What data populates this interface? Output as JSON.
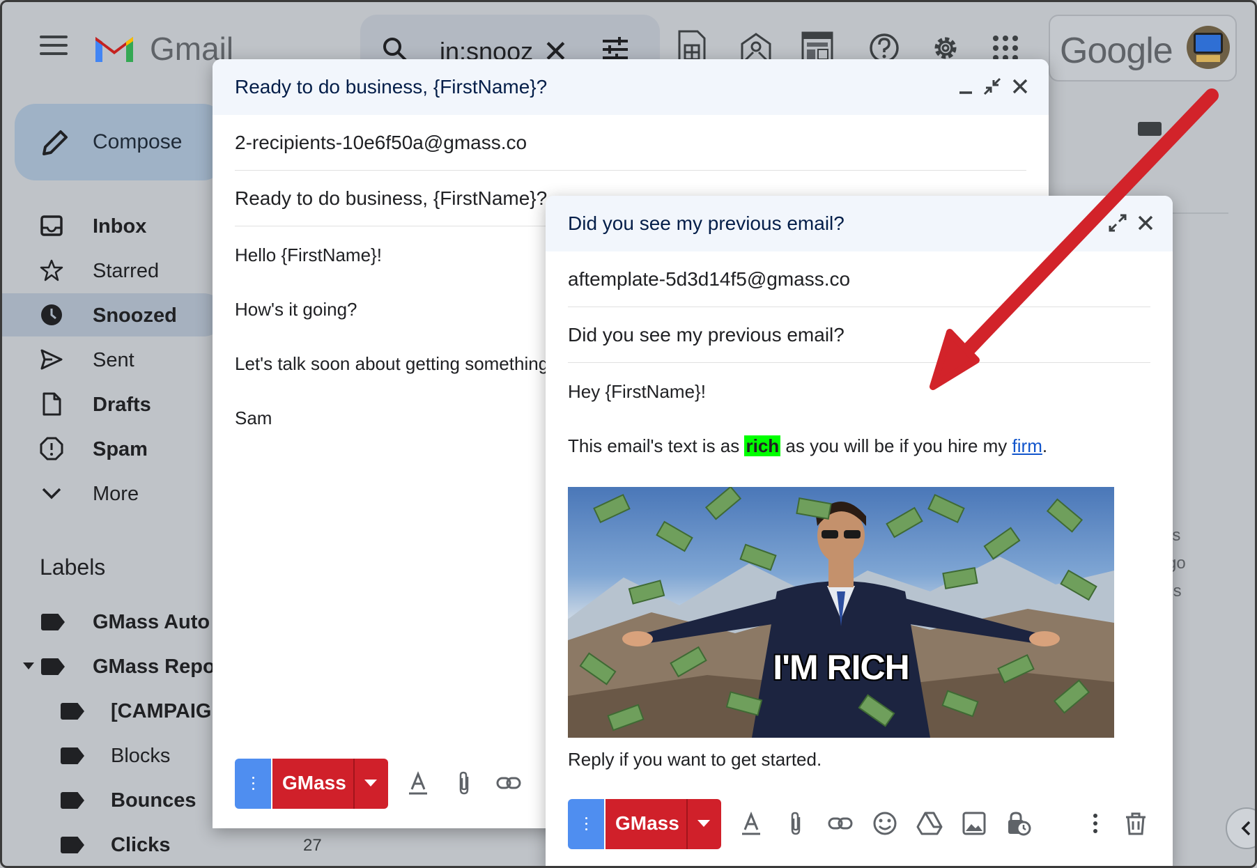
{
  "app": {
    "name": "Gmail",
    "account_brand": "Google"
  },
  "search": {
    "query": "in:snooz"
  },
  "nav": {
    "compose_label": "Compose",
    "items": [
      {
        "label": "Inbox",
        "bold": true
      },
      {
        "label": "Starred",
        "bold": false
      },
      {
        "label": "Snoozed",
        "bold": true,
        "active": true
      },
      {
        "label": "Sent",
        "bold": false
      },
      {
        "label": "Drafts",
        "bold": true
      },
      {
        "label": "Spam",
        "bold": true
      },
      {
        "label": "More",
        "bold": false
      }
    ]
  },
  "labels": {
    "title": "Labels",
    "items": [
      {
        "label": "GMass Auto",
        "bold": true
      },
      {
        "label": "GMass Repo",
        "bold": true
      },
      {
        "label": "[CAMPAIG",
        "bold": true
      },
      {
        "label": "Blocks",
        "bold": false
      },
      {
        "label": "Bounces",
        "bold": true
      },
      {
        "label": "Clicks",
        "bold": true,
        "count": "27"
      }
    ]
  },
  "background_fragments": [
    "es",
    "go",
    "ils"
  ],
  "draft1": {
    "header_title": "Ready to do business, {FirstName}?",
    "to": "2-recipients-10e6f50a@gmass.co",
    "subject": "Ready to do business, {FirstName}?",
    "body": [
      "Hello {FirstName}!",
      "How's it going?",
      "Let's talk soon about getting something",
      "Sam"
    ],
    "gmass_label": "GMass"
  },
  "draft2": {
    "header_title": "Did you see my previous email?",
    "to": "aftemplate-5d3d14f5@gmass.co",
    "subject": "Did you see my previous email?",
    "greeting": "Hey {FirstName}!",
    "line_prefix": "This email's text is as ",
    "line_highlight": "rich",
    "line_middle": " as you will be if you hire my ",
    "line_link": "firm",
    "line_suffix": ".",
    "image_caption": "I'M RICH",
    "closing": "Reply if you want to get started.",
    "gmass_label": "GMass"
  },
  "colors": {
    "annotation_arrow": "#d2232a",
    "gmass_red": "#d0202a",
    "toolbar_blue": "#4f8ef0",
    "highlight": "#00ff00"
  }
}
